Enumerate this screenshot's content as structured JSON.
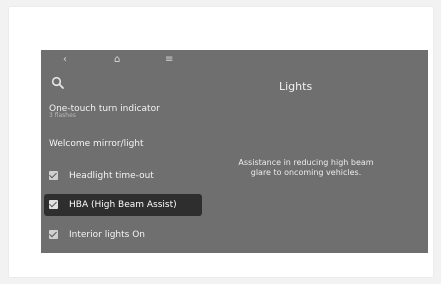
{
  "nav": {
    "back_icon": "chevron-left-icon",
    "home_icon": "home-icon",
    "menu_icon": "menu-icon",
    "back_glyph": "‹",
    "home_glyph": "⌂",
    "menu_glyph": "≡"
  },
  "header": {
    "title": "Lights",
    "search_icon": "search-icon"
  },
  "menu": {
    "items": [
      {
        "label": "One-touch turn indicator",
        "sub": "3 flashes"
      },
      {
        "label": "Welcome mirror/light"
      },
      {
        "label": "Headlight time-out",
        "checked": true
      },
      {
        "label": "HBA (High Beam Assist)",
        "checked": true,
        "selected": true
      },
      {
        "label": "Interior lights On",
        "checked": true
      }
    ]
  },
  "detail": {
    "description": "Assistance in reducing high beam glare to oncoming vehicles."
  },
  "colors": {
    "screen_bg": "#6f6f6f",
    "selected_bg": "#2e2e2e",
    "text": "#f4f4f4"
  }
}
